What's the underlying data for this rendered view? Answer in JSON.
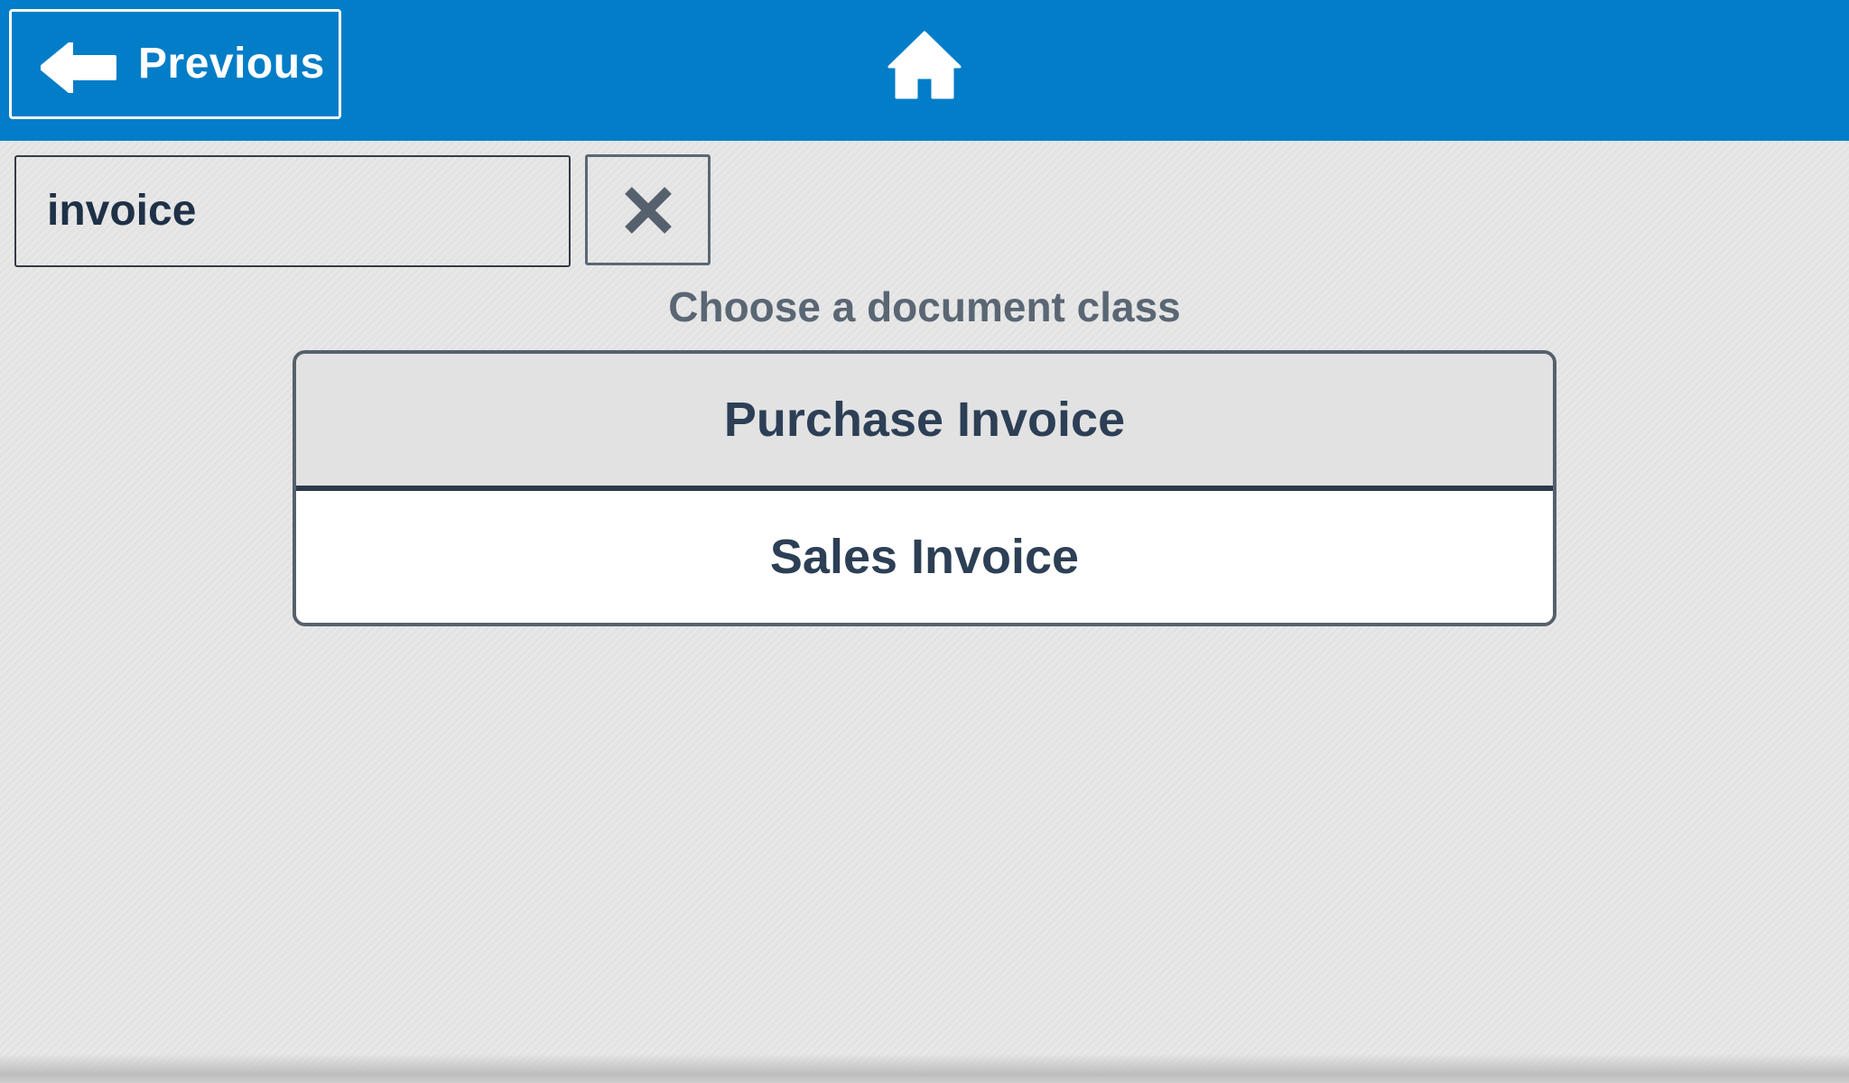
{
  "header": {
    "back_label": "Previous",
    "back_icon": "arrow-left-icon",
    "home_icon": "home-icon",
    "background_color": "#027dc8"
  },
  "search": {
    "value": "invoice",
    "clear_icon": "close-icon"
  },
  "prompt": "Choose a document class",
  "document_classes": [
    {
      "label": "Purchase Invoice",
      "highlighted": true
    },
    {
      "label": "Sales Invoice",
      "highlighted": false
    }
  ]
}
